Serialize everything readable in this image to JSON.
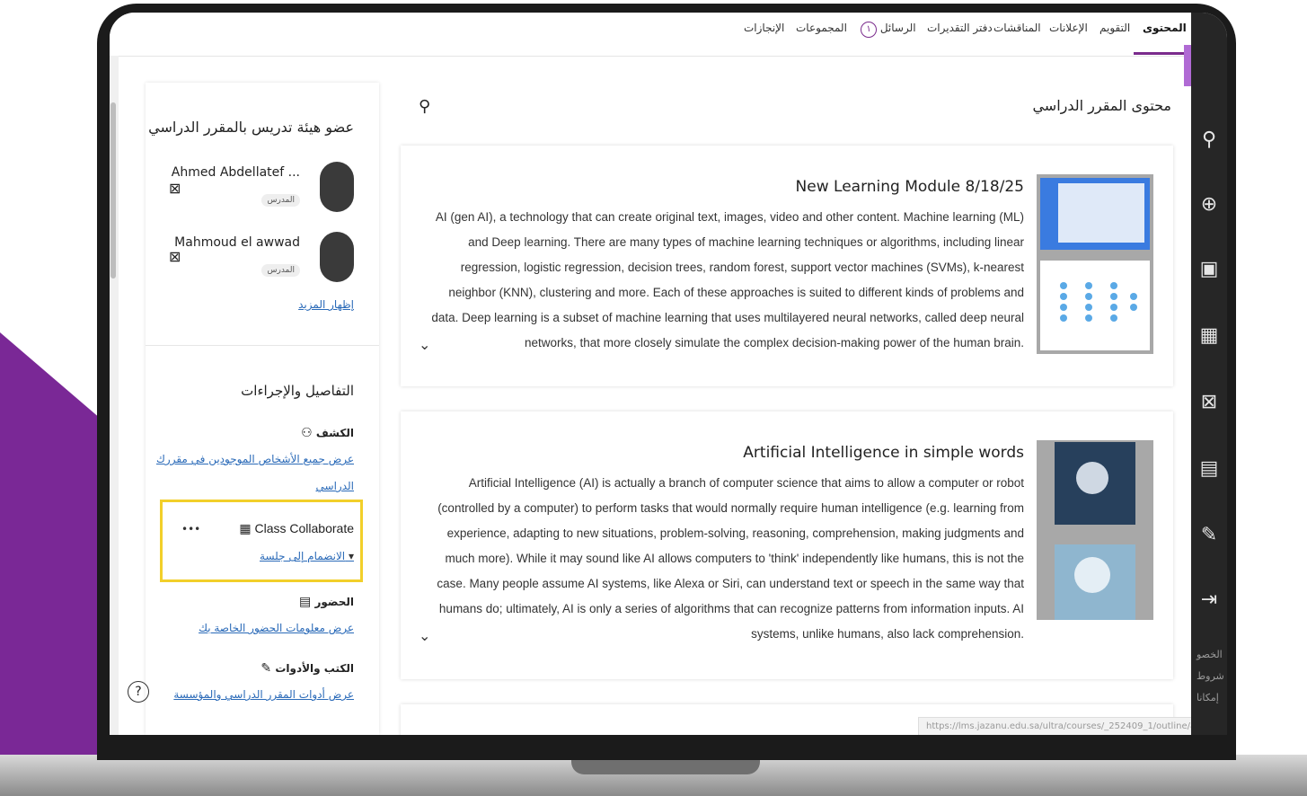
{
  "nav": {
    "items": [
      "المحتوى",
      "التقويم",
      "الإعلانات",
      "المناقشات",
      "دفتر التقديرات",
      "الرسائل",
      "المجموعات",
      "الإنجازات"
    ],
    "messages_count": "١",
    "active": "المحتوى"
  },
  "close_label": "X",
  "main": {
    "title": "محتوى المقرر الدراسي",
    "cards": [
      {
        "title": "New Learning Module 8/18/25",
        "body": "AI (gen AI), a technology that can create original text, images, video and other content. Machine learning (ML) and Deep learning. There are many types of machine learning techniques or algorithms, including linear regression, logistic regression, decision trees, random forest, support vector machines (SVMs), k-nearest neighbor (KNN), clustering and more. Each of these approaches is suited to different kinds of problems and data. Deep learning is a subset of machine learning that uses multilayered neural networks, called deep neural networks, that more closely simulate the complex decision-making power of the human brain."
      },
      {
        "title": "Artificial Intelligence in simple words",
        "body": "Artificial Intelligence (AI) is actually a branch of computer science that aims to allow a computer or robot (controlled by a computer) to perform tasks that would normally require human intelligence (e.g. learning from experience, adapting to new situations, problem-solving, reasoning, comprehension, making judgments and much more). While it may sound like AI allows computers to 'think' independently like humans, this is not the case. Many people assume AI systems, like Alexa or Siri, can understand text or speech in the same way that humans do; ultimately, AI is only a series of algorithms that can recognize patterns from information inputs. AI systems, unlike humans, also lack comprehension."
      }
    ]
  },
  "sidebar": {
    "instructors_title": "عضو هيئة تدريس بالمقرر الدراسي",
    "instructors": [
      {
        "name": "Ahmed Abdellatef ...",
        "role": "المدرس"
      },
      {
        "name": "Mahmoud el awwad",
        "role": "المدرس"
      }
    ],
    "show_more": "إظهار المزيد",
    "details_title": "التفاصيل والإجراءات",
    "roster_head": "الكشف",
    "roster_link_line1": "عرض جميع الأشخاص الموجودين في مقررك",
    "roster_link_line2": "الدراسي",
    "collab_title": "Class Collaborate",
    "collab_more": "•••",
    "collab_join": "الانضمام إلى جلسة",
    "attendance_head": "الحضور",
    "attendance_link": "عرض معلومات الحضور الخاصة بك",
    "tools_head": "الكتب والأدوات",
    "tools_link": "عرض أدوات المقرر الدراسي والمؤسسة"
  },
  "right_strip": {
    "icons": [
      "user-icon",
      "globe-icon",
      "courses-icon",
      "calendar-icon",
      "messages-icon",
      "grades-icon",
      "edit-icon",
      "signout-icon"
    ],
    "text_lines": [
      "الخصو",
      "شروط",
      "إمكانا"
    ]
  },
  "status_url": "https://lms.jazanu.edu.sa/ultra/courses/_252409_1/outline/assess",
  "help_label": "?",
  "colors": {
    "accent": "#7a2b8c",
    "close_bg": "#b06ad4",
    "highlight": "#f2cf2a",
    "arrow": "#f0a02a",
    "deco": "#7a2896",
    "link": "#2a6ab8"
  }
}
